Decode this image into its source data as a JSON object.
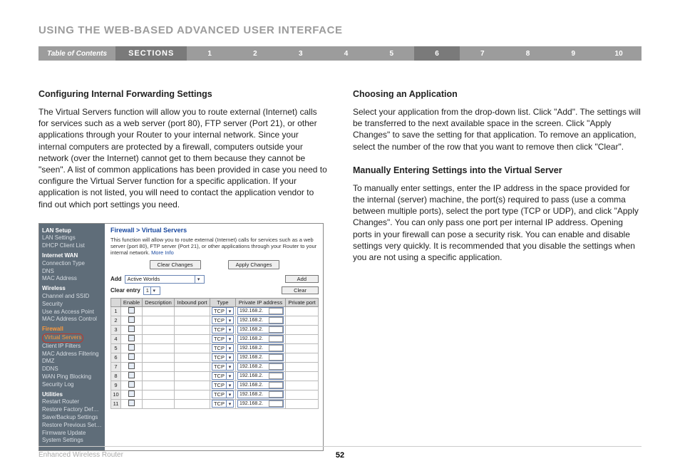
{
  "title": "USING THE WEB-BASED ADVANCED USER INTERFACE",
  "bar": {
    "toc": "Table of Contents",
    "sections": "SECTIONS",
    "items": [
      "1",
      "2",
      "3",
      "4",
      "5",
      "6",
      "7",
      "8",
      "9",
      "10"
    ],
    "active_index": 5
  },
  "left": {
    "h1": "Configuring Internal Forwarding Settings",
    "p1": "The Virtual Servers function will allow you to route external (Internet) calls for services such as a web server (port 80), FTP server (Port 21), or other applications through your Router to your internal network. Since your internal computers are protected by a firewall, computers outside your network (over the Internet) cannot get to them because they cannot be \"seen\". A list of common applications has been provided in case you need to configure the Virtual Server function for a specific application. If your application is not listed, you will need to contact the application vendor to find out which port settings you need."
  },
  "right": {
    "h1": "Choosing an Application",
    "p1": "Select your application from the drop-down list. Click \"Add\". The settings will be transferred to the next available space in the screen. Click \"Apply Changes\" to save the setting for that application. To remove an application, select the number of the row that you want to remove then click \"Clear\".",
    "h2": "Manually Entering Settings into the Virtual Server",
    "p2": "To manually enter settings, enter the IP address in the space provided for the internal (server) machine, the port(s) required to pass (use a comma between multiple ports), select the port type (TCP or UDP), and click \"Apply Changes\". You can only pass one port per internal IP address. Opening ports in your firewall can pose a security risk. You can enable and disable settings very quickly. It is recommended that you disable the settings when you are not using a specific application."
  },
  "router": {
    "breadcrumb": "Firewall > Virtual Servers",
    "intro": "This function will allow you to route external (Internet) calls for services such as a web server (port 80), FTP server (Port 21), or other applications through your Router to your internal network.",
    "more": "More Info",
    "clear_changes": "Clear Changes",
    "apply_changes": "Apply Changes",
    "add_label": "Add",
    "add_selected": "Active Worlds",
    "add_button": "Add",
    "clear_label": "Clear entry",
    "clear_selected": "1",
    "clear_button": "Clear",
    "headers": [
      "",
      "Enable",
      "Description",
      "Inbound port",
      "Type",
      "Private IP address",
      "Private port"
    ],
    "rows": [
      {
        "idx": "1",
        "type": "TCP",
        "ip": "192.168.2."
      },
      {
        "idx": "2",
        "type": "TCP",
        "ip": "192.168.2."
      },
      {
        "idx": "3",
        "type": "TCP",
        "ip": "192.168.2."
      },
      {
        "idx": "4",
        "type": "TCP",
        "ip": "192.168.2."
      },
      {
        "idx": "5",
        "type": "TCP",
        "ip": "192.168.2."
      },
      {
        "idx": "6",
        "type": "TCP",
        "ip": "192.168.2."
      },
      {
        "idx": "7",
        "type": "TCP",
        "ip": "192.168.2."
      },
      {
        "idx": "8",
        "type": "TCP",
        "ip": "192.168.2."
      },
      {
        "idx": "9",
        "type": "TCP",
        "ip": "192.168.2."
      },
      {
        "idx": "10",
        "type": "TCP",
        "ip": "192.168.2."
      },
      {
        "idx": "11",
        "type": "TCP",
        "ip": "192.168.2."
      }
    ],
    "sidebar": {
      "groups": [
        {
          "header": "LAN Setup",
          "items": [
            "LAN Settings",
            "DHCP Client List"
          ]
        },
        {
          "header": "Internet WAN",
          "items": [
            "Connection Type",
            "DNS",
            "MAC Address"
          ]
        },
        {
          "header": "Wireless",
          "items": [
            "Channel and SSID",
            "Security",
            "Use as Access Point",
            "MAC Address Control"
          ]
        },
        {
          "header_special": "Firewall",
          "highlight": "Virtual Servers",
          "items": [
            "Client IP Filters",
            "MAC Address Filtering",
            "DMZ",
            "DDNS",
            "WAN Ping Blocking",
            "Security Log"
          ]
        },
        {
          "header": "Utilities",
          "items": [
            "Restart Router",
            "Restore Factory Defaults",
            "Save/Backup Settings",
            "Restore Previous Settings",
            "Firmware Update",
            "System Settings"
          ]
        }
      ]
    }
  },
  "footer": {
    "product": "Enhanced Wireless Router",
    "page": "52"
  }
}
